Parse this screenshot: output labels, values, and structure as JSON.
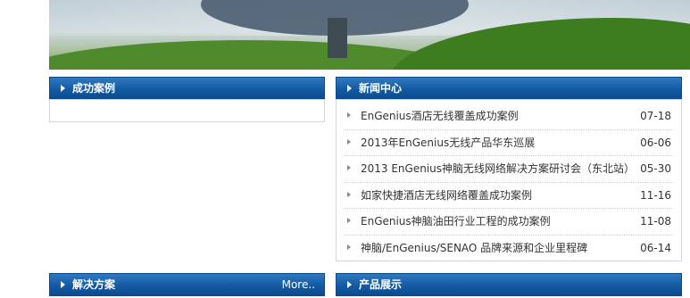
{
  "panels": {
    "cases": {
      "title": "成功案例"
    },
    "news": {
      "title": "新闻中心",
      "items": [
        {
          "text": "EnGenius酒店无线覆盖成功案例",
          "date": "07-18"
        },
        {
          "text": "2013年EnGenius无线产品华东巡展",
          "date": "06-06"
        },
        {
          "text": "2013 EnGenius神脑无线网络解决方案研讨会（东北站）",
          "date": "05-30"
        },
        {
          "text": "如家快捷酒店无线网络覆盖成功案例",
          "date": "11-16"
        },
        {
          "text": "EnGenius神脑油田行业工程的成功案例",
          "date": "11-08"
        },
        {
          "text": "神脑/EnGenius/SENAO 品牌来源和企业里程碑",
          "date": "06-14"
        }
      ]
    },
    "solutions": {
      "title": "解决方案",
      "more": "More.."
    },
    "products": {
      "title": "产品展示"
    }
  },
  "colors": {
    "header_blue": "#135aa3",
    "border_gray": "#d7d7d7"
  }
}
